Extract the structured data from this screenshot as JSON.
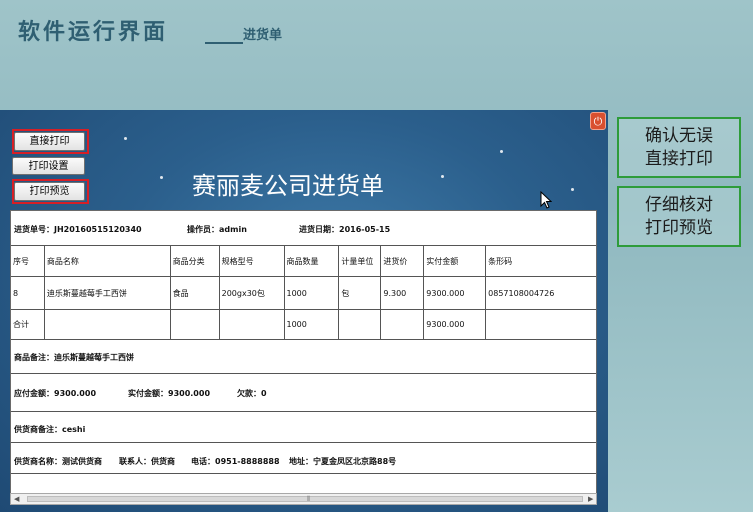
{
  "slide": {
    "title": "软件运行界面",
    "subtitle": "进货单"
  },
  "toolbar": {
    "print_direct": "直接打印",
    "print_settings": "打印设置",
    "print_preview": "打印预览"
  },
  "window": {
    "close_symbol": "⏻"
  },
  "document": {
    "title": "赛丽麦公司进货单",
    "header": {
      "order_no_label": "进货单号：",
      "order_no": "JH20160515120340",
      "operator_label": "操作员：",
      "operator": "admin",
      "date_label": "进货日期：",
      "date": "2016-05-15"
    },
    "columns": [
      "序号",
      "商品名称",
      "商品分类",
      "规格型号",
      "商品数量",
      "计量单位",
      "进货价",
      "实付金额",
      "条形码"
    ],
    "rows": [
      [
        "8",
        "迪乐斯蔓越莓手工西饼",
        "食品",
        "200gx30包",
        "1000",
        "包",
        "9.300",
        "9300.000",
        "0857108004726"
      ]
    ],
    "total_row": {
      "label": "合计",
      "quantity": "1000",
      "amount": "9300.000"
    },
    "note_label": "商品备注：",
    "note": "迪乐斯蔓越莓手工西饼",
    "payable_label": "应付金额：",
    "payable": "9300.000",
    "paid_label": "实付金额：",
    "paid": "9300.000",
    "debt_label": "欠款：",
    "debt": "0",
    "supplier_note_label": "供货商备注：",
    "supplier_note": "ceshi",
    "supplier_name_label": "供货商名称：",
    "supplier_name": "测试供货商",
    "contact_label": "联系人：",
    "contact": "供货商",
    "phone_label": "电话：",
    "phone": "0951-8888888",
    "address_label": "地址：",
    "address": "宁夏金凤区北京路88号"
  },
  "callouts": {
    "direct_print": [
      "确认无误",
      "直接打印"
    ],
    "preview": [
      "仔细核对",
      "打印预览"
    ]
  },
  "colors": {
    "highlight_frame": "#d61f26",
    "callout_border": "#2e9c3a",
    "window_bg": "#2b5f8c"
  }
}
